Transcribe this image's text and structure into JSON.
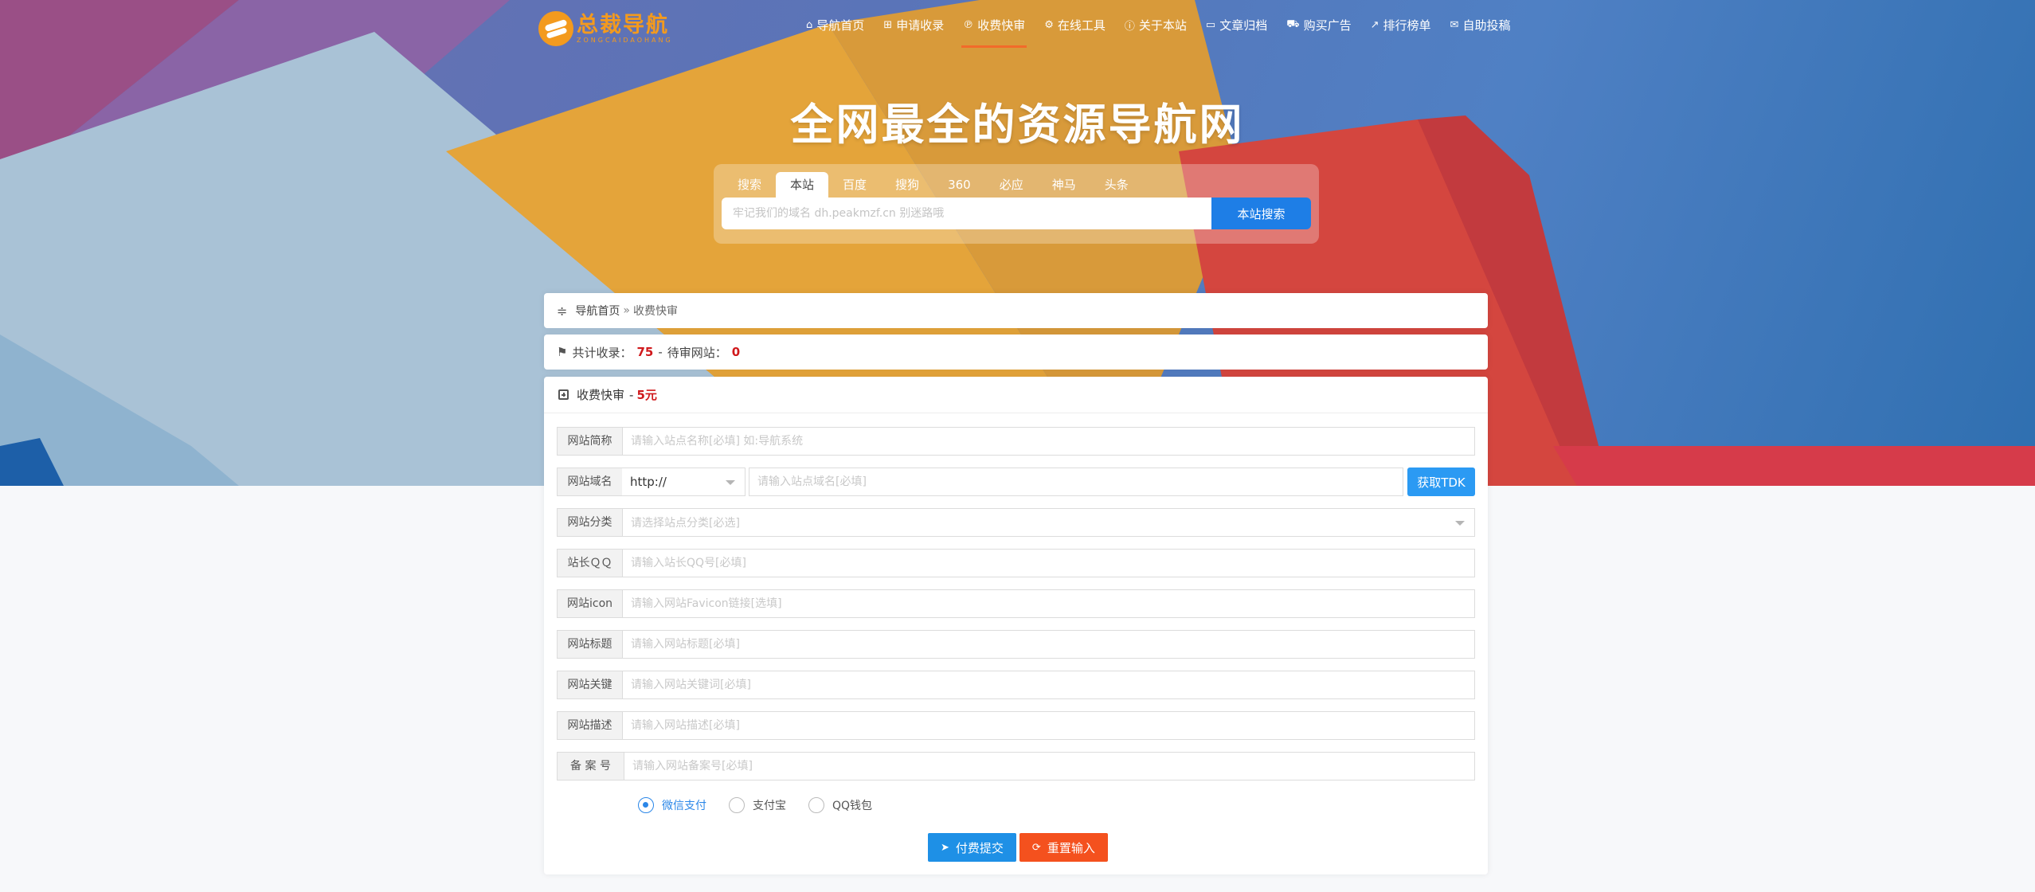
{
  "logo": {
    "title": "总裁导航",
    "subtitle": "ZONGCAIDAOHANG"
  },
  "nav": [
    {
      "icon": "home-icon",
      "glyph": "⌂",
      "label": "导航首页",
      "active": false
    },
    {
      "icon": "plus-square-icon",
      "glyph": "⊞",
      "label": "申请收录",
      "active": false
    },
    {
      "icon": "paypal-icon",
      "glyph": "℗",
      "label": "收费快审",
      "active": true
    },
    {
      "icon": "gears-icon",
      "glyph": "⚙",
      "label": "在线工具",
      "active": false
    },
    {
      "icon": "info-circle-icon",
      "glyph": "ⓘ",
      "label": "关于本站",
      "active": false
    },
    {
      "icon": "folder-open-icon",
      "glyph": "▭",
      "label": "文章归档",
      "active": false
    },
    {
      "icon": "shopping-cart-icon",
      "glyph": "⛟",
      "label": "购买广告",
      "active": false
    },
    {
      "icon": "line-chart-icon",
      "glyph": "↗",
      "label": "排行榜单",
      "active": false
    },
    {
      "icon": "envelope-open-icon",
      "glyph": "✉",
      "label": "自助投稿",
      "active": false
    }
  ],
  "headline": "全网最全的资源导航网",
  "search": {
    "tabs": [
      "搜索",
      "本站",
      "百度",
      "搜狗",
      "360",
      "必应",
      "神马",
      "头条"
    ],
    "active_tab": 1,
    "placeholder": "牢记我们的域名 dh.peakmzf.cn 别迷路哦",
    "button": "本站搜索"
  },
  "breadcrumb": {
    "home": "导航首页",
    "separator": "»",
    "current": "收费快审"
  },
  "stats": {
    "label_total": "共计收录：",
    "total": "75",
    "dash": "-",
    "label_pending": "待审网站：",
    "pending": "0"
  },
  "form": {
    "title": "收费快审",
    "price_prefix": "-",
    "price": "5元",
    "fields": {
      "name": {
        "label": "网站简称",
        "placeholder": "请输入站点名称[必填] 如:导航系统"
      },
      "domain": {
        "label": "网站域名",
        "protocol": "http://",
        "placeholder": "请输入站点域名[必填]",
        "button": "获取TDK"
      },
      "category": {
        "label": "网站分类",
        "placeholder": "请选择站点分类[必选]"
      },
      "qq": {
        "label": "站长ＱＱ",
        "placeholder": "请输入站长QQ号[必填]"
      },
      "icon": {
        "label": "网站icon",
        "placeholder": "请输入网站Favicon链接[选填]"
      },
      "title": {
        "label": "网站标题",
        "placeholder": "请输入网站标题[必填]"
      },
      "keywords": {
        "label": "网站关键",
        "placeholder": "请输入网站关键词[必填]"
      },
      "description": {
        "label": "网站描述",
        "placeholder": "请输入网站描述[必填]"
      },
      "icp": {
        "label": "备 案 号",
        "placeholder": "请输入网站备案号[必填]"
      }
    },
    "payment": [
      "微信支付",
      "支付宝",
      "QQ钱包"
    ],
    "payment_selected": 0,
    "submit": "付费提交",
    "reset": "重置输入"
  },
  "colors": {
    "accent": "#1e7ee6",
    "danger": "#d0191c",
    "reset": "#f4511e",
    "nav_active": "#f26b2a",
    "logo": "#f39a1e"
  }
}
